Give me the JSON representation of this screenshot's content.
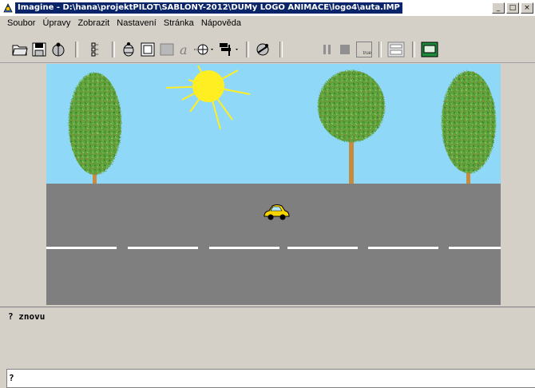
{
  "window": {
    "title": "Imagine - D:\\hana\\projektPILOT\\SABLONY-2012\\DUMy LOGO ANIMACE\\logo4\\auta.IMP",
    "controls": {
      "minimize": "_",
      "maximize": "□",
      "close": "×"
    }
  },
  "menu": [
    "Soubor",
    "Úpravy",
    "Zobrazit",
    "Nastavení",
    "Stránka",
    "Nápověda"
  ],
  "toolbar": {
    "icons": [
      "open-folder-icon",
      "save-disk-icon",
      "ladybug-icon",
      "turtle-list-icon",
      "new-turtle-icon",
      "rectangle-icon",
      "filled-rectangle-icon",
      "text-tool-icon",
      "compass-dropdown-icon",
      "turtle-shape-dropdown-icon",
      "run-icon",
      "pause-icon",
      "stop-icon",
      "true-icon",
      "page-icon",
      "screen-icon"
    ],
    "true_label": "true"
  },
  "command_history": [
    "? znovu"
  ],
  "command_input": {
    "value": "?"
  },
  "scene": {
    "sky_color": "#8fd8f8",
    "road_color": "#7f7f7f",
    "ground_color": "#7f7f7f",
    "sun_color": "#ffee22",
    "tree_foliage_color": "#5aa23a",
    "trunk_color": "#c88a3c",
    "car_color": "#f5d400"
  },
  "colors": {
    "titlebar_active": "#0a246a",
    "menu_bg": "#d4d0c8"
  }
}
